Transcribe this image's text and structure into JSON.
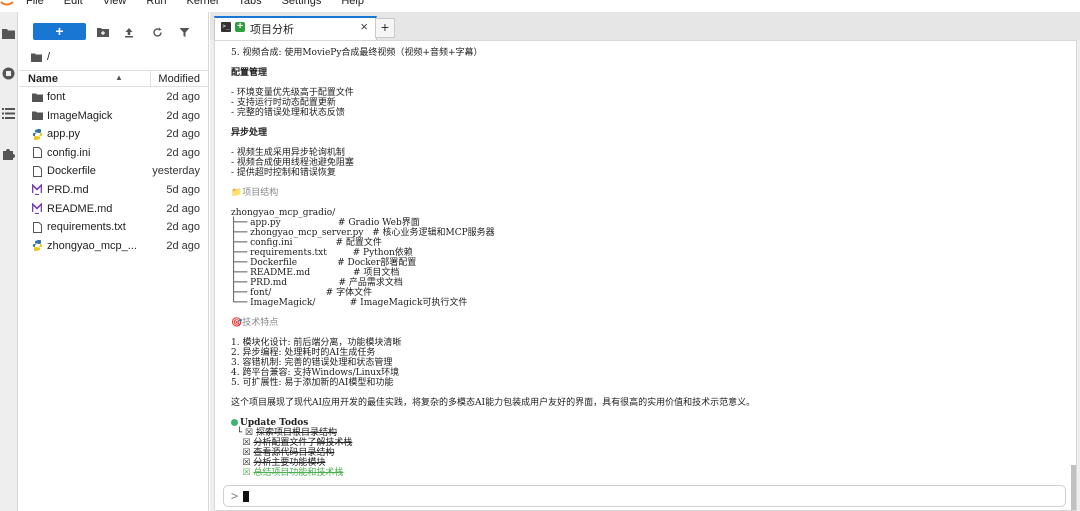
{
  "menubar": {
    "items": [
      "File",
      "Edit",
      "View",
      "Run",
      "Kernel",
      "Tabs",
      "Settings",
      "Help"
    ]
  },
  "filebrowser": {
    "new_label": "+",
    "breadcrumb": "/",
    "header": {
      "name": "Name",
      "modified": "Modified"
    },
    "files": [
      {
        "name": "font",
        "modified": "2d ago",
        "icon": "folder-icon"
      },
      {
        "name": "ImageMagick",
        "modified": "2d ago",
        "icon": "folder-icon"
      },
      {
        "name": "app.py",
        "modified": "2d ago",
        "icon": "python-file-icon"
      },
      {
        "name": "config.ini",
        "modified": "2d ago",
        "icon": "file-icon"
      },
      {
        "name": "Dockerfile",
        "modified": "yesterday",
        "icon": "file-icon"
      },
      {
        "name": "PRD.md",
        "modified": "5d ago",
        "icon": "markdown-file-icon"
      },
      {
        "name": "README.md",
        "modified": "2d ago",
        "icon": "markdown-file-icon"
      },
      {
        "name": "requirements.txt",
        "modified": "2d ago",
        "icon": "file-icon"
      },
      {
        "name": "zhongyao_mcp_...",
        "modified": "2d ago",
        "icon": "python-file-icon"
      }
    ]
  },
  "tabs": {
    "active_label": "项目分析",
    "close": "×",
    "add": "+"
  },
  "terminal": {
    "lines": [
      {
        "text": "5. 视频合成: 使用MoviePy合成最终视频（视频+音频+字幕）",
        "style": ""
      },
      {
        "text": "",
        "style": "gap"
      },
      {
        "text": "配置管理",
        "style": "bold"
      },
      {
        "text": "",
        "style": "gap"
      },
      {
        "text": "- 环境变量优先级高于配置文件",
        "style": ""
      },
      {
        "text": "- 支持运行时动态配置更新",
        "style": ""
      },
      {
        "text": "- 完整的错误处理和状态反馈",
        "style": ""
      },
      {
        "text": "",
        "style": "gap"
      },
      {
        "text": "异步处理",
        "style": "bold"
      },
      {
        "text": "",
        "style": "gap"
      },
      {
        "text": "- 视频生成采用异步轮询机制",
        "style": ""
      },
      {
        "text": "- 视频合成使用线程池避免阻塞",
        "style": ""
      },
      {
        "text": "- 提供超时控制和错误恢复",
        "style": ""
      },
      {
        "text": "",
        "style": "gap"
      },
      {
        "text": "📁项目结构",
        "style": "muted"
      },
      {
        "text": "",
        "style": "gap"
      },
      {
        "text": "zhongyao_mcp_gradio/",
        "style": ""
      },
      {
        "text": "├── app.py                    # Gradio Web界面",
        "style": ""
      },
      {
        "text": "├── zhongyao_mcp_server.py   # 核心业务逻辑和MCP服务器",
        "style": ""
      },
      {
        "text": "├── config.ini               # 配置文件",
        "style": ""
      },
      {
        "text": "├── requirements.txt         # Python依赖",
        "style": ""
      },
      {
        "text": "├── Dockerfile              # Docker部署配置",
        "style": ""
      },
      {
        "text": "├── README.md               # 项目文档",
        "style": ""
      },
      {
        "text": "├── PRD.md                  # 产品需求文档",
        "style": ""
      },
      {
        "text": "├── font/                   # 字体文件",
        "style": ""
      },
      {
        "text": "└── ImageMagick/            # ImageMagick可执行文件",
        "style": ""
      },
      {
        "text": "",
        "style": "gap"
      },
      {
        "text": "🎯技术特点",
        "style": "muted"
      },
      {
        "text": "",
        "style": "gap"
      },
      {
        "text": "1. 模块化设计: 前后端分离，功能模块清晰",
        "style": ""
      },
      {
        "text": "2. 异步编程: 处理耗时的AI生成任务",
        "style": ""
      },
      {
        "text": "3. 容错机制: 完善的错误处理和状态管理",
        "style": ""
      },
      {
        "text": "4. 跨平台兼容: 支持Windows/Linux环境",
        "style": ""
      },
      {
        "text": "5. 可扩展性: 易于添加新的AI模型和功能",
        "style": ""
      },
      {
        "text": "",
        "style": "gap"
      },
      {
        "text": "这个项目展现了现代AI应用开发的最佳实践，将复杂的多模态AI能力包装成用户友好的界面，具有很高的实用价值和技术示范意义。",
        "style": ""
      },
      {
        "text": "",
        "style": "gap"
      }
    ],
    "todos_title": "Update Todos",
    "todos": [
      {
        "text": "探索项目根目录结构",
        "style": "done"
      },
      {
        "text": "分析配置文件了解技术栈",
        "style": "done"
      },
      {
        "text": "查看源代码目录结构",
        "style": "done"
      },
      {
        "text": "分析主要功能模块",
        "style": "done"
      },
      {
        "text": "总结项目功能和技术栈",
        "style": "done-green"
      }
    ],
    "prompt": ">"
  }
}
